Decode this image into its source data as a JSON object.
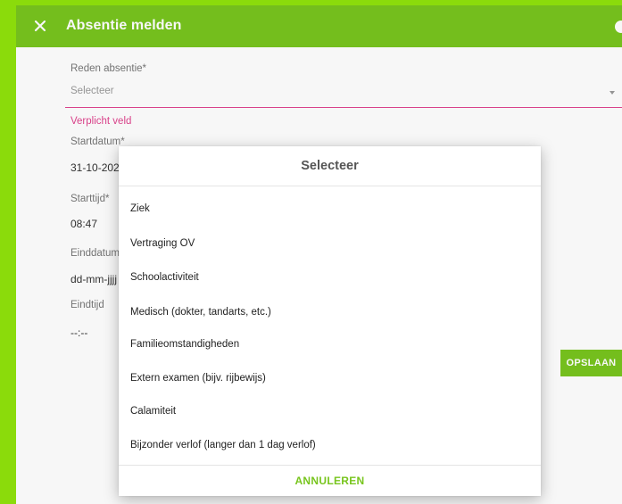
{
  "header": {
    "title": "Absentie melden",
    "close_icon": "close-icon"
  },
  "form": {
    "reason_label": "Reden absentie*",
    "reason_placeholder": "Selecteer",
    "reason_error": "Verplicht veld",
    "start_date_label": "Startdatum*",
    "start_date_value": "31-10-202",
    "start_time_label": "Starttijd*",
    "start_time_value": "08:47",
    "end_date_label": "Einddatum",
    "end_date_value": "dd-mm-jjjj",
    "end_time_label": "Eindtijd",
    "end_time_value": "--:--",
    "save_label": "OPSLAAN"
  },
  "dialog": {
    "title": "Selecteer",
    "options": [
      "Ziek",
      "Vertraging OV",
      "Schoolactiviteit",
      "Medisch (dokter, tandarts, etc.)",
      "Familieomstandigheden",
      "Extern examen (bijv. rijbewijs)",
      "Calamiteit",
      "Bijzonder verlof (langer dan 1 dag verlof)"
    ],
    "cancel_label": "ANNULEREN"
  },
  "colors": {
    "brand_green": "#78c51e",
    "outer_green": "#8bdb0b",
    "error_pink": "#e0458f"
  }
}
